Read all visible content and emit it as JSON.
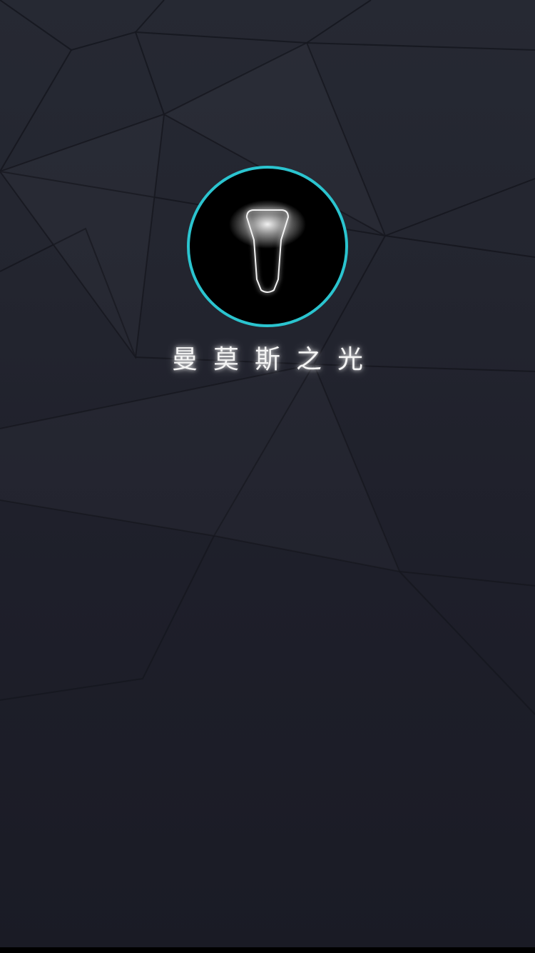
{
  "app": {
    "title": "曼莫斯之光",
    "logo_icon": "light-bulb-icon",
    "accent_color": "#2bc4cf",
    "background_color": "#23252f"
  }
}
